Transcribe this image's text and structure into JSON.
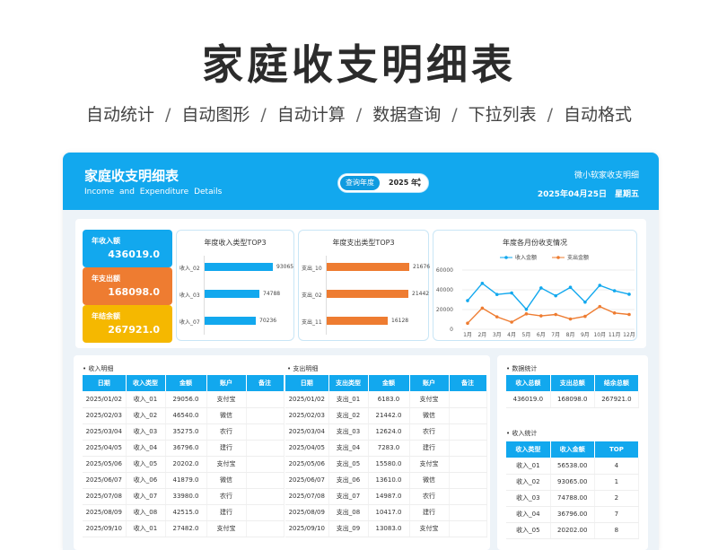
{
  "hero": {
    "title": "家庭收支明细表",
    "features": [
      "自动统计",
      "自动图形",
      "自动计算",
      "数据查询",
      "下拉列表",
      "自动格式"
    ],
    "separator": "/"
  },
  "header": {
    "title": "家庭收支明细表",
    "subtitle": "Income and Expenditure Details",
    "query_label": "查询年度",
    "query_year": "2025 年",
    "spin_up": "▲",
    "spin_down": "▼",
    "brand": "微小软家收支明细",
    "date": "2025年04月25日　星期五"
  },
  "kpis": [
    {
      "label": "年收入额",
      "value": "436019.0",
      "color": "#12a8ee"
    },
    {
      "label": "年支出额",
      "value": "168098.0",
      "color": "#ee7c31"
    },
    {
      "label": "年结余额",
      "value": "267921.0",
      "color": "#f5b800"
    }
  ],
  "income_top3": {
    "title": "年度收入类型TOP3",
    "color": "#12a8ee",
    "chart_data": {
      "type": "bar",
      "categories": [
        "收入_02",
        "收入_03",
        "收入_07"
      ],
      "values": [
        93065,
        74788,
        70236
      ]
    }
  },
  "expense_top3": {
    "title": "年度支出类型TOP3",
    "color": "#ee7c31",
    "chart_data": {
      "type": "bar",
      "categories": [
        "支出_10",
        "支出_02",
        "支出_11"
      ],
      "values": [
        21676,
        21442,
        16128
      ]
    }
  },
  "monthly": {
    "title": "年度各月份收支情况",
    "chart_data": {
      "type": "line",
      "categories": [
        "1月",
        "2月",
        "3月",
        "4月",
        "5月",
        "6月",
        "7月",
        "8月",
        "9月",
        "10月",
        "11月",
        "12月"
      ],
      "series": [
        {
          "name": "收入金额",
          "color": "#12a8ee",
          "values": [
            29056,
            46540,
            35275,
            36796,
            20202,
            41879,
            33980,
            42515,
            27482,
            44500,
            39000,
            35500
          ]
        },
        {
          "name": "支出金额",
          "color": "#ee7c31",
          "values": [
            6183,
            21442,
            12624,
            7283,
            15580,
            13610,
            14987,
            10417,
            13083,
            23000,
            16500,
            15000
          ]
        }
      ],
      "yticks": [
        "60000",
        "40000",
        "20000",
        "0"
      ],
      "ylim": [
        0,
        60000
      ],
      "legend": "top"
    }
  },
  "income_detail": {
    "title": "• 收入明细",
    "columns": [
      "日期",
      "收入类型",
      "金额",
      "账户",
      "备注"
    ],
    "rows": [
      [
        "2025/01/02",
        "收入_01",
        "29056.0",
        "支付宝",
        ""
      ],
      [
        "2025/02/03",
        "收入_02",
        "46540.0",
        "微信",
        ""
      ],
      [
        "2025/03/04",
        "收入_03",
        "35275.0",
        "农行",
        ""
      ],
      [
        "2025/04/05",
        "收入_04",
        "36796.0",
        "建行",
        ""
      ],
      [
        "2025/05/06",
        "收入_05",
        "20202.0",
        "支付宝",
        ""
      ],
      [
        "2025/06/07",
        "收入_06",
        "41879.0",
        "微信",
        ""
      ],
      [
        "2025/07/08",
        "收入_07",
        "33980.0",
        "农行",
        ""
      ],
      [
        "2025/08/09",
        "收入_08",
        "42515.0",
        "建行",
        ""
      ],
      [
        "2025/09/10",
        "收入_01",
        "27482.0",
        "支付宝",
        ""
      ]
    ]
  },
  "expense_detail": {
    "title": "• 支出明细",
    "columns": [
      "日期",
      "支出类型",
      "金额",
      "账户",
      "备注"
    ],
    "rows": [
      [
        "2025/01/02",
        "支出_01",
        "6183.0",
        "支付宝",
        ""
      ],
      [
        "2025/02/03",
        "支出_02",
        "21442.0",
        "微信",
        ""
      ],
      [
        "2025/03/04",
        "支出_03",
        "12624.0",
        "农行",
        ""
      ],
      [
        "2025/04/05",
        "支出_04",
        "7283.0",
        "建行",
        ""
      ],
      [
        "2025/05/06",
        "支出_05",
        "15580.0",
        "支付宝",
        ""
      ],
      [
        "2025/06/07",
        "支出_06",
        "13610.0",
        "微信",
        ""
      ],
      [
        "2025/07/08",
        "支出_07",
        "14987.0",
        "农行",
        ""
      ],
      [
        "2025/08/09",
        "支出_08",
        "10417.0",
        "建行",
        ""
      ],
      [
        "2025/09/10",
        "支出_09",
        "13083.0",
        "支付宝",
        ""
      ]
    ]
  },
  "stats": {
    "title": "• 数据统计",
    "columns": [
      "收入总额",
      "支出总额",
      "结余总额"
    ],
    "row": [
      "436019.0",
      "168098.0",
      "267921.0"
    ]
  },
  "income_stats": {
    "title": "• 收入统计",
    "columns": [
      "收入类型",
      "收入金额",
      "TOP"
    ],
    "rows": [
      [
        "收入_01",
        "56538.00",
        "4"
      ],
      [
        "收入_02",
        "93065.00",
        "1"
      ],
      [
        "收入_03",
        "74788.00",
        "2"
      ],
      [
        "收入_04",
        "36796.00",
        "7"
      ],
      [
        "收入_05",
        "20202.00",
        "8"
      ]
    ]
  }
}
